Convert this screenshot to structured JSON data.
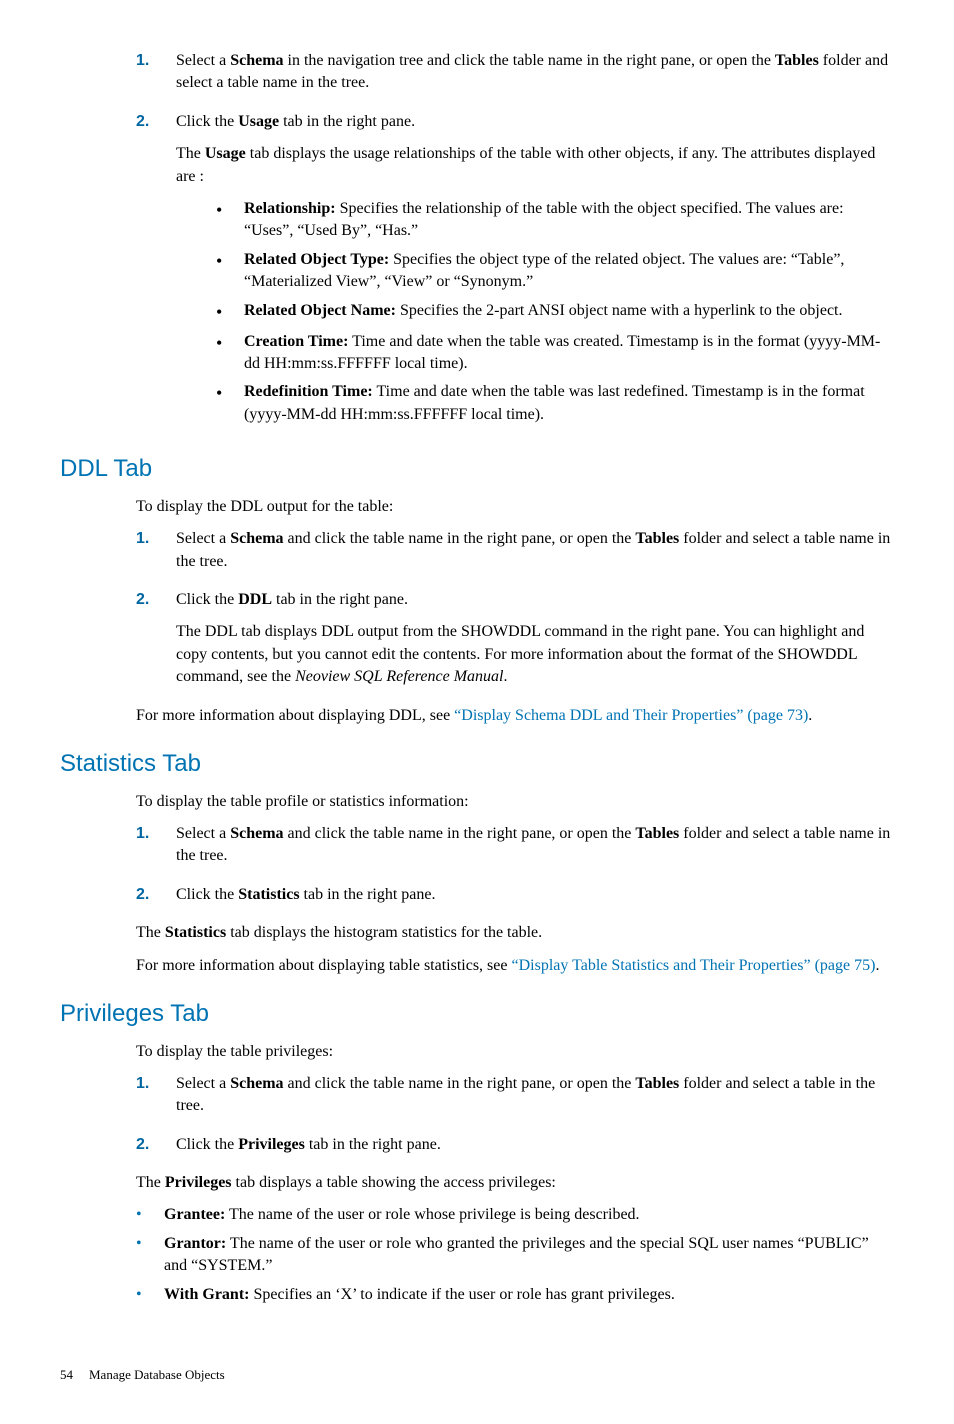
{
  "usage_step1_part1": "Select a ",
  "bold_schema": "Schema",
  "usage_step1_part2": " in the navigation tree and click the table name in the right pane, or open the ",
  "bold_tables": "Tables",
  "usage_step1_part3": " folder and select a table name in the tree.",
  "usage_step2_part1": "Click the ",
  "bold_usage": "Usage",
  "usage_step2_part2": " tab in the right pane.",
  "usage_desc_part1": "The ",
  "usage_desc_part2": " tab displays the usage relationships of the table with other objects, if any. The attributes displayed are :",
  "bullet_relationship_label": "Relationship:",
  "bullet_relationship_text": " Specifies the relationship of the table with the object specified. The values are: “Uses”, “Used By”, “Has.”",
  "bullet_relobjtype_label": "Related Object Type:",
  "bullet_relobjtype_text": " Specifies the object type of the related object. The values are: “Table”, “Materialized View”, “View” or “Synonym.”",
  "bullet_relobjname_label": "Related Object Name:",
  "bullet_relobjname_text": " Specifies the 2-part ANSI object name with a hyperlink to the object.",
  "bullet_creationtime_label": "Creation Time:",
  "bullet_creationtime_text": " Time and date when the table was created. Timestamp is in the format (yyyy-MM-dd HH:mm:ss.FFFFFF local time).",
  "bullet_redeftime_label": "Redefinition Time:",
  "bullet_redeftime_text": " Time and date when the table was last redefined. Timestamp is in the format (yyyy-MM-dd HH:mm:ss.FFFFFF local time).",
  "h2_ddl": "DDL Tab",
  "ddl_intro": "To display the DDL output for the table:",
  "ddl_step1_part1": "Select a ",
  "ddl_step1_part2": " and click the table name in the right pane, or open the ",
  "ddl_step1_part3": " folder and select a table name in the tree.",
  "ddl_step2_part1": "Click the ",
  "bold_ddl": "DDL",
  "ddl_step2_part2": " tab in the right pane.",
  "ddl_desc_part1": "The DDL tab displays DDL output from the SHOWDDL command in the right pane. You can highlight and copy contents, but you cannot edit the contents. For more information about the format of the SHOWDDL command, see the ",
  "italic_neoview": "Neoview SQL Reference Manual",
  "ddl_desc_part2": ".",
  "ddl_more_part1": "For more information about displaying DDL, see ",
  "ddl_more_link": "“Display Schema DDL and Their Properties” (page 73)",
  "ddl_more_part2": ".",
  "h2_stats": "Statistics Tab",
  "stats_intro": "To display the table profile or statistics information:",
  "stats_step1_part1": "Select a ",
  "stats_step1_part2": " and click the table name in the right pane, or open the ",
  "stats_step1_part3": " folder and select a table name in the tree.",
  "stats_step2_part1": "Click the ",
  "bold_statistics": "Statistics",
  "stats_step2_part2": " tab in the right pane.",
  "stats_desc_part1": "The ",
  "stats_desc_part2": " tab displays the histogram statistics for the table.",
  "stats_more_part1": "For more information about displaying table statistics, see ",
  "stats_more_link": "“Display Table Statistics and Their Properties” (page 75)",
  "stats_more_part2": ".",
  "h2_priv": "Privileges Tab",
  "priv_intro": "To display the table privileges:",
  "priv_step1_part1": "Select a ",
  "priv_step1_part2": " and click the table name in the right pane, or open the ",
  "priv_step1_part3": " folder and select a table in the tree.",
  "priv_step2_part1": "Click the ",
  "bold_privileges": "Privileges",
  "priv_step2_part2": " tab in the right pane.",
  "priv_desc_part1": "The ",
  "priv_desc_part2": " tab displays a table showing the access privileges:",
  "bullet_grantee_label": "Grantee:",
  "bullet_grantee_text": " The name of the user or role whose privilege is being described.",
  "bullet_grantor_label": "Grantor:",
  "bullet_grantor_text": " The name of the user or role who granted the privileges and the special SQL user names “PUBLIC” and “SYSTEM.”",
  "bullet_withgrant_label": "With Grant:",
  "bullet_withgrant_text": " Specifies an ‘X’ to indicate if the user or role has grant privileges.",
  "page_number": "54",
  "chapter_title": "Manage Database Objects",
  "num1": "1.",
  "num2": "2.",
  "bullet_char": "•"
}
